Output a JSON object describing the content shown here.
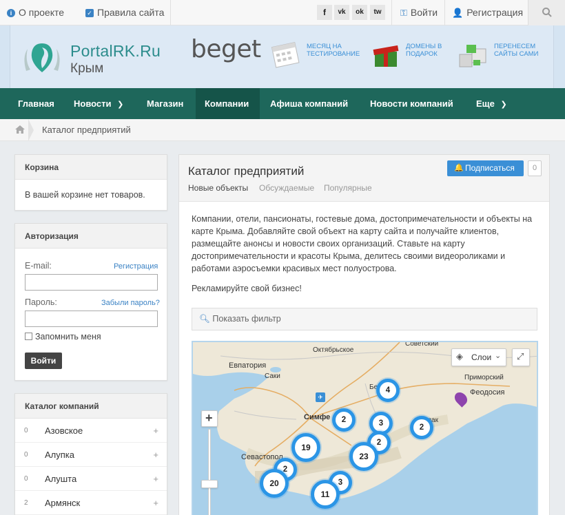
{
  "topbar": {
    "about": "О проекте",
    "rules": "Правила сайта",
    "social": [
      "f",
      "vk",
      "ok",
      "tw"
    ],
    "login": "Войти",
    "register": "Регистрация"
  },
  "header": {
    "logo_title": "PortalRK.Ru",
    "logo_subtitle": "Крым",
    "sponsor": "beget",
    "promos": [
      {
        "line1": "МЕСЯЦ НА",
        "line2": "ТЕСТИРОВАНИЕ"
      },
      {
        "line1": "ДОМЕНЫ В",
        "line2": "ПОДАРОК"
      },
      {
        "line1": "ПЕРЕНЕСЕМ",
        "line2": "САЙТЫ САМИ"
      }
    ]
  },
  "nav": [
    "Главная",
    "Новости",
    "Магазин",
    "Компании",
    "Афиша компаний",
    "Новости компаний",
    "Еще"
  ],
  "breadcrumb": "Каталог предприятий",
  "cart": {
    "title": "Корзина",
    "empty": "В вашей корзине нет товаров."
  },
  "auth": {
    "title": "Авторизация",
    "email_label": "E-mail:",
    "register_link": "Регистрация",
    "password_label": "Пароль:",
    "forgot_link": "Забыли пароль?",
    "remember": "Запомнить меня",
    "login_btn": "Войти"
  },
  "catalog": {
    "title": "Каталог компаний",
    "items": [
      {
        "count": "0",
        "name": "Азовское"
      },
      {
        "count": "0",
        "name": "Алупка"
      },
      {
        "count": "0",
        "name": "Алушта"
      },
      {
        "count": "2",
        "name": "Армянск"
      }
    ]
  },
  "main": {
    "title": "Каталог предприятий",
    "tabs": [
      "Новые объекты",
      "Обсуждаемые",
      "Популярные"
    ],
    "subscribe": "Подписаться",
    "subscribe_count": "0",
    "description": "Компании, отели, пансионаты, гостевые дома, достопримечательности и объекты на карте Крыма. Добавляйте свой объект на карту сайта и получайте клиентов, размещайте анонсы и новости своих организаций. Ставьте на карту достопримечательности и красоты Крыма, делитесь своими видеороликами и работами аэросъемки красивых мест полуострова.",
    "ad_text": "Рекламируйте свой бизнес!",
    "filter": "Показать фильтр"
  },
  "map": {
    "layers_btn": "Слои",
    "cities": [
      "Советский",
      "Октябрьское",
      "Евпатория",
      "Саки",
      "Приморский",
      "Феодосия",
      "Симферополь",
      "Севастополь",
      "Белогорск",
      "Судак"
    ],
    "clusters": [
      "4",
      "2",
      "3",
      "2",
      "2",
      "19",
      "23",
      "2",
      "3",
      "20",
      "11"
    ]
  }
}
